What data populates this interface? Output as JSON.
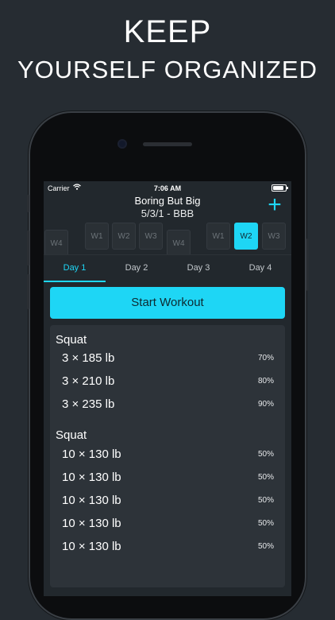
{
  "headline": {
    "line1": "KEEP",
    "line2": "YOURSELF ORGANIZED"
  },
  "status_bar": {
    "carrier": "Carrier",
    "time": "7:06 AM"
  },
  "nav": {
    "title": "Boring But Big",
    "subtitle": "5/3/1 - BBB",
    "add_label": "+"
  },
  "weeks": [
    "W4",
    "W1",
    "W2",
    "W3",
    "W4",
    "W1",
    "W2",
    "W3"
  ],
  "active_week_index": 6,
  "tabs": [
    "Day 1",
    "Day 2",
    "Day 3",
    "Day 4"
  ],
  "active_tab_index": 0,
  "start_button": "Start Workout",
  "exercises": [
    {
      "name": "Squat",
      "sets": [
        {
          "sets": "3 × 185 lb",
          "pct": "70%"
        },
        {
          "sets": "3 × 210 lb",
          "pct": "80%"
        },
        {
          "sets": "3 × 235 lb",
          "pct": "90%"
        }
      ]
    },
    {
      "name": "Squat",
      "sets": [
        {
          "sets": "10 × 130 lb",
          "pct": "50%"
        },
        {
          "sets": "10 × 130 lb",
          "pct": "50%"
        },
        {
          "sets": "10 × 130 lb",
          "pct": "50%"
        },
        {
          "sets": "10 × 130 lb",
          "pct": "50%"
        },
        {
          "sets": "10 × 130 lb",
          "pct": "50%"
        }
      ]
    }
  ],
  "colors": {
    "accent": "#1ed6f5",
    "background": "#262c32",
    "card": "#2d3339"
  }
}
